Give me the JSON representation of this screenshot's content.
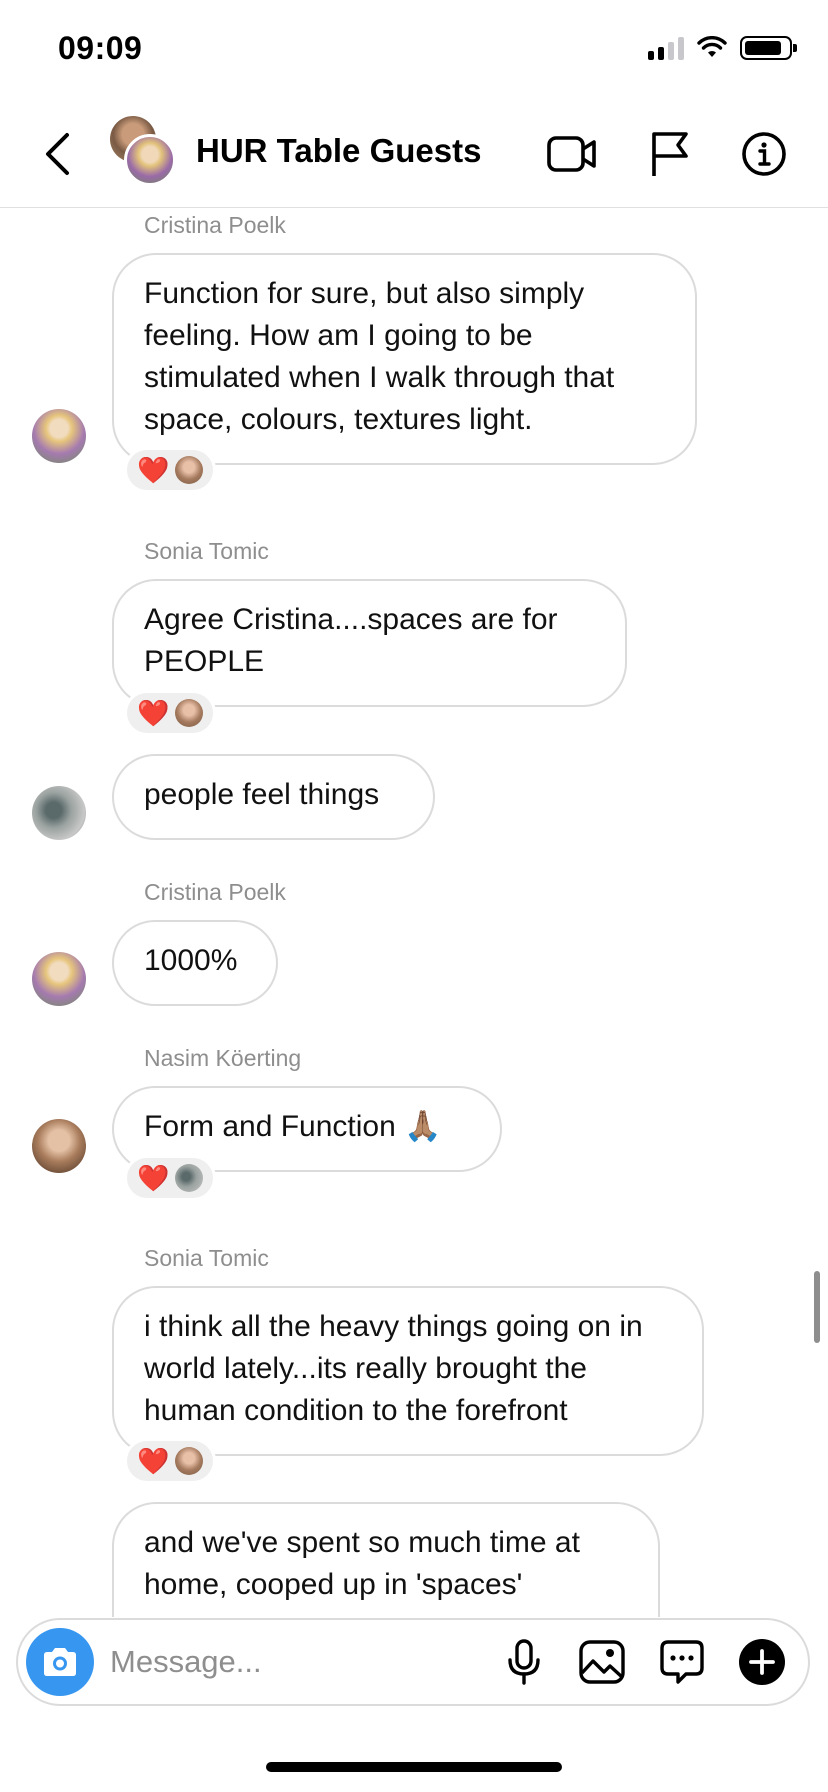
{
  "status_bar": {
    "time": "09:09"
  },
  "header": {
    "title": "HUR Table Guests"
  },
  "messages": [
    {
      "sender": "Cristina Poelk",
      "text": "Function for sure, but also simply feeling. How am I going to be stimulated when I walk through that space, colours, textures light.",
      "reaction": "❤️"
    },
    {
      "sender": "Sonia Tomic",
      "text": "Agree Cristina....spaces are for PEOPLE",
      "reaction": "❤️"
    },
    {
      "sender": "",
      "text": "people feel things"
    },
    {
      "sender": "Cristina Poelk",
      "text": "1000%"
    },
    {
      "sender": "Nasim Köerting",
      "text": "Form and Function 🙏🏽",
      "reaction": "❤️"
    },
    {
      "sender": "Sonia Tomic",
      "text": "i think all the heavy things going on in world lately...its really brought the human condition to the forefront",
      "reaction": "❤️"
    },
    {
      "sender": "",
      "text": "and we've spent so much time at home, cooped up in 'spaces'"
    }
  ],
  "composer": {
    "placeholder": "Message..."
  },
  "icons": {
    "back": "chevron-left-icon",
    "video": "video-camera-icon",
    "report": "flag-icon",
    "info": "info-icon",
    "camera": "camera-icon",
    "mic": "microphone-icon",
    "gallery": "image-icon",
    "sticker": "chat-bubble-icon",
    "add": "plus-circle-icon"
  },
  "colors": {
    "accent": "#3797f0",
    "heart": "#ed4956",
    "meta_text": "#8e8e8e",
    "bubble_border": "#dbdbdb"
  }
}
